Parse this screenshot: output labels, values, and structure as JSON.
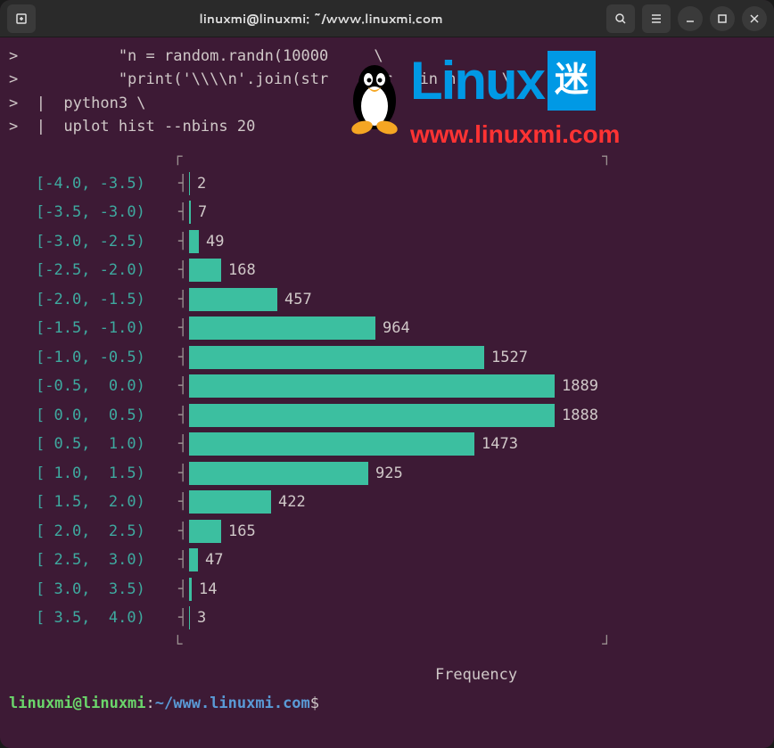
{
  "titlebar": {
    "title": "linuxmi@linuxmi: ~/www.linuxmi.com"
  },
  "cmd": {
    "line1": ">           \"n = random.randn(10000     \\",
    "line2": ">           \"print('\\\\\\\\n'.join(str    for   in n     \\",
    "line3": ">  |  python3 \\",
    "line4": ">  |  uplot hist --nbins 20"
  },
  "chart_data": {
    "type": "bar",
    "orientation": "horizontal",
    "title": "",
    "xlabel": "Frequency",
    "ylabel": "",
    "bins": [
      {
        "label": "[-4.0, -3.5)",
        "value": 2
      },
      {
        "label": "[-3.5, -3.0)",
        "value": 7
      },
      {
        "label": "[-3.0, -2.5)",
        "value": 49
      },
      {
        "label": "[-2.5, -2.0)",
        "value": 168
      },
      {
        "label": "[-2.0, -1.5)",
        "value": 457
      },
      {
        "label": "[-1.5, -1.0)",
        "value": 964
      },
      {
        "label": "[-1.0, -0.5)",
        "value": 1527
      },
      {
        "label": "[-0.5,  0.0)",
        "value": 1889
      },
      {
        "label": "[ 0.0,  0.5)",
        "value": 1888
      },
      {
        "label": "[ 0.5,  1.0)",
        "value": 1473
      },
      {
        "label": "[ 1.0,  1.5)",
        "value": 925
      },
      {
        "label": "[ 1.5,  2.0)",
        "value": 422
      },
      {
        "label": "[ 2.0,  2.5)",
        "value": 165
      },
      {
        "label": "[ 2.5,  3.0)",
        "value": 47
      },
      {
        "label": "[ 3.0,  3.5)",
        "value": 14
      },
      {
        "label": "[ 3.5,  4.0)",
        "value": 3
      }
    ],
    "max_value": 1889,
    "bar_color": "#3cbfa0",
    "label_color": "#3ea99f"
  },
  "chart_border": {
    "top": "                  ┌                                              ┐",
    "bottom": "                  └                                              ┘"
  },
  "prompt": {
    "user": "linuxmi@linuxmi",
    "sep1": ":",
    "path": "~/www.linuxmi.com",
    "sep2": "$"
  },
  "watermark": {
    "linux": "Linux",
    "mi": "迷",
    "url": "www.linuxmi.com"
  }
}
